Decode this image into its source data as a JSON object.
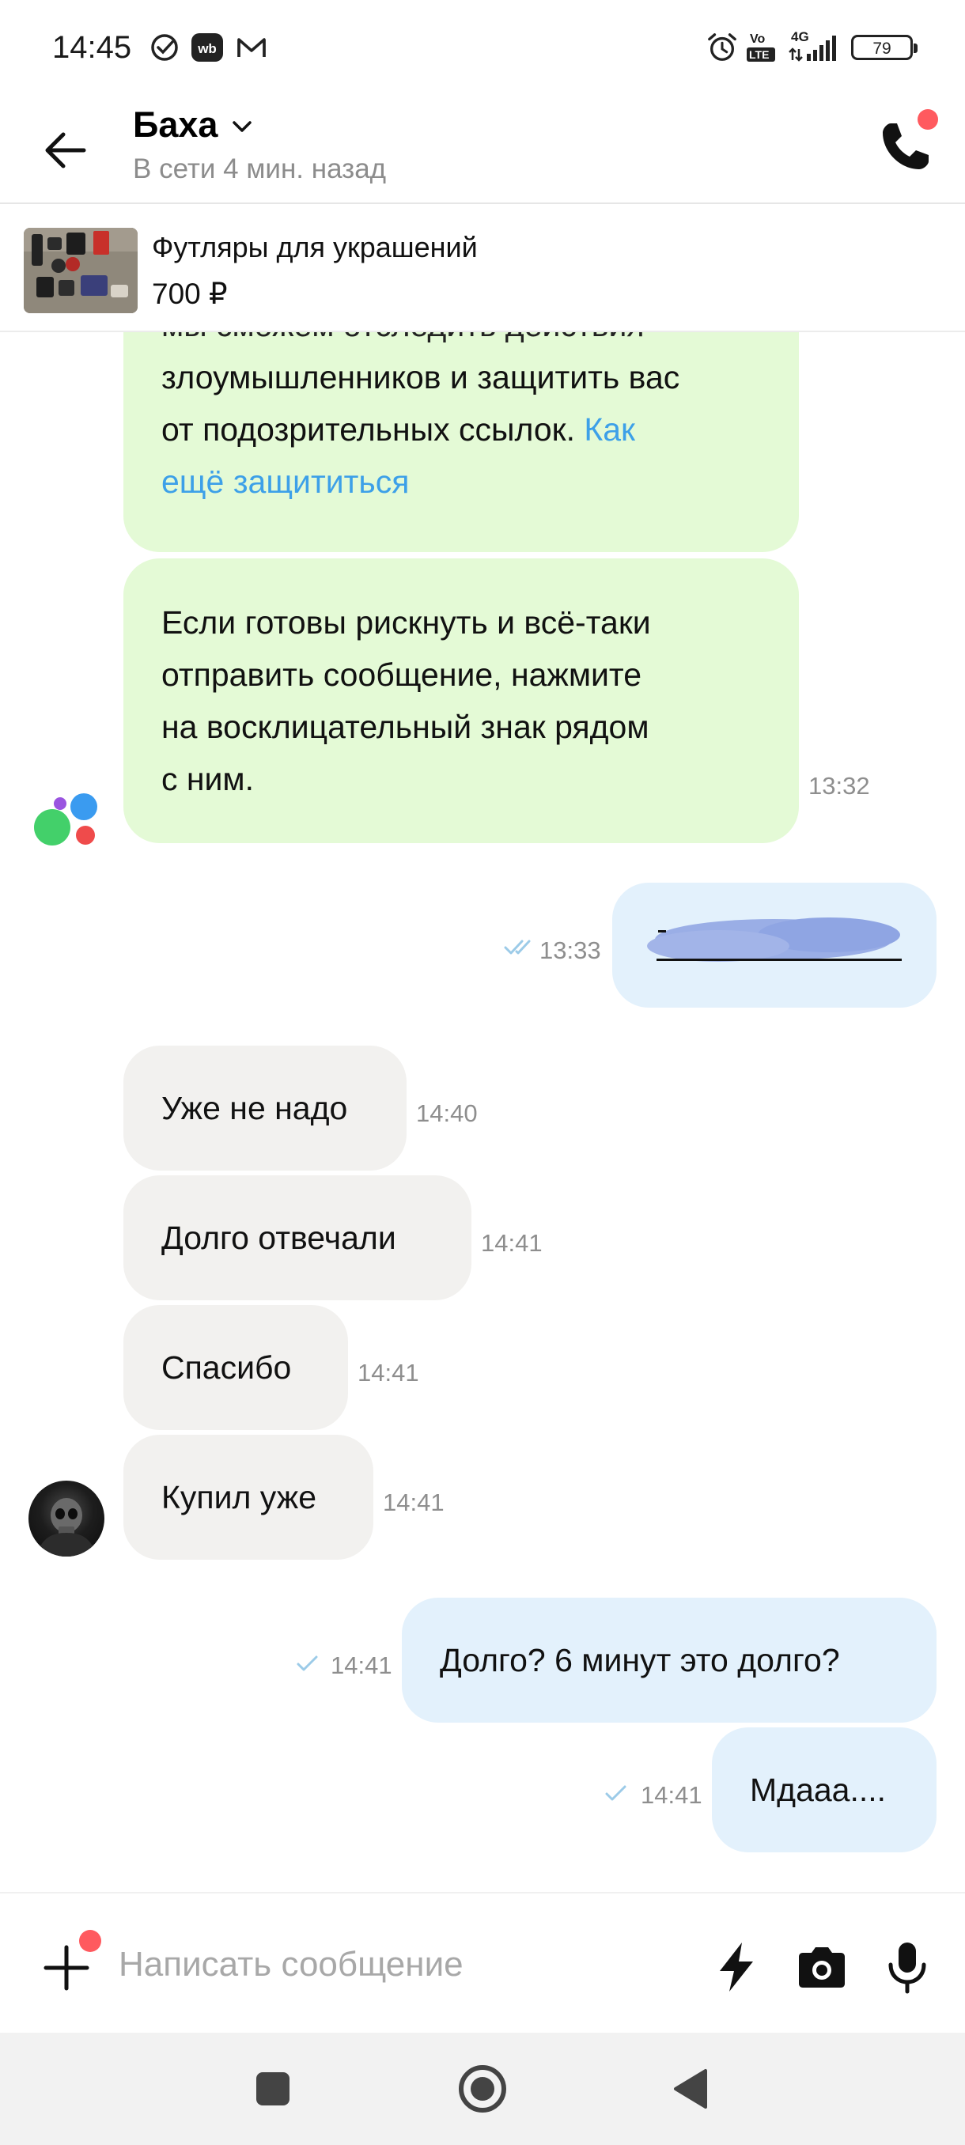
{
  "status_bar": {
    "time": "14:45",
    "volte_label_top": "Vo",
    "volte_label_bottom": "LTE",
    "network": "4G",
    "battery": "79",
    "icons": [
      "check-circle-icon",
      "wb-icon",
      "gmail-icon",
      "alarm-icon",
      "volte-icon",
      "signal-icon",
      "battery-icon"
    ]
  },
  "header": {
    "name": "Баха",
    "status": "В сети 4 мин. назад",
    "notification_color": "#ff5a5f"
  },
  "product": {
    "title": "Футляры для украшений",
    "price": "700 ₽"
  },
  "messages": {
    "m1": {
      "line0": "мы сможем отследить действия",
      "line1": "злоумышленников и защитить вас",
      "line2_text": "от подозрительных ссылок. ",
      "line2_link": "Как",
      "line3_link": "ещё защититься"
    },
    "m2": {
      "line1": "Если готовы рискнуть и всё-таки",
      "line2": "отправить сообщение, нажмите",
      "line3": "на восклицательный знак рядом",
      "line4": "с ним.",
      "time": "13:32"
    },
    "m3": {
      "time": "13:33"
    },
    "m4": {
      "text": "Уже не надо",
      "time": "14:40"
    },
    "m5": {
      "text": "Долго отвечали",
      "time": "14:41"
    },
    "m6": {
      "text": "Спасибо",
      "time": "14:41"
    },
    "m7": {
      "text": "Купил уже",
      "time": "14:41"
    },
    "m8": {
      "text": "Долго? 6 минут это долго?",
      "time": "14:41"
    },
    "m9": {
      "text": "Мдааа....",
      "time": "14:41"
    }
  },
  "composer": {
    "placeholder": "Написать сообщение"
  },
  "colors": {
    "incoming_system": "#e4fad6",
    "incoming": "#f2f1ef",
    "outgoing": "#e3f1fc",
    "link": "#3da0e8",
    "read_tick": "#9ccbe8"
  }
}
